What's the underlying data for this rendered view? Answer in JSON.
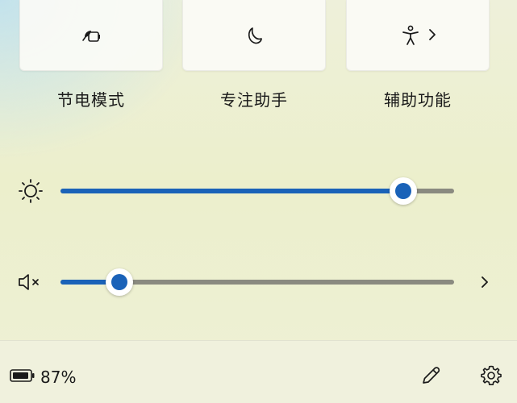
{
  "quick_actions": [
    {
      "label": "节电模式",
      "icon": "battery-saver-icon",
      "has_chevron": false
    },
    {
      "label": "专注助手",
      "icon": "moon-icon",
      "has_chevron": false
    },
    {
      "label": "辅助功能",
      "icon": "accessibility-icon",
      "has_chevron": true
    }
  ],
  "brightness": {
    "icon": "sun-icon",
    "level_percent": 87
  },
  "volume": {
    "icon": "speaker-muted-icon",
    "level_percent": 15,
    "muted": true
  },
  "footer": {
    "battery_icon": "battery-icon",
    "battery_percent": "87%",
    "edit_icon": "pencil-icon",
    "settings_icon": "gear-icon"
  },
  "colors": {
    "accent": "#1a62b8",
    "track": "#8a8a80",
    "tile_bg": "#fbfbf6"
  }
}
